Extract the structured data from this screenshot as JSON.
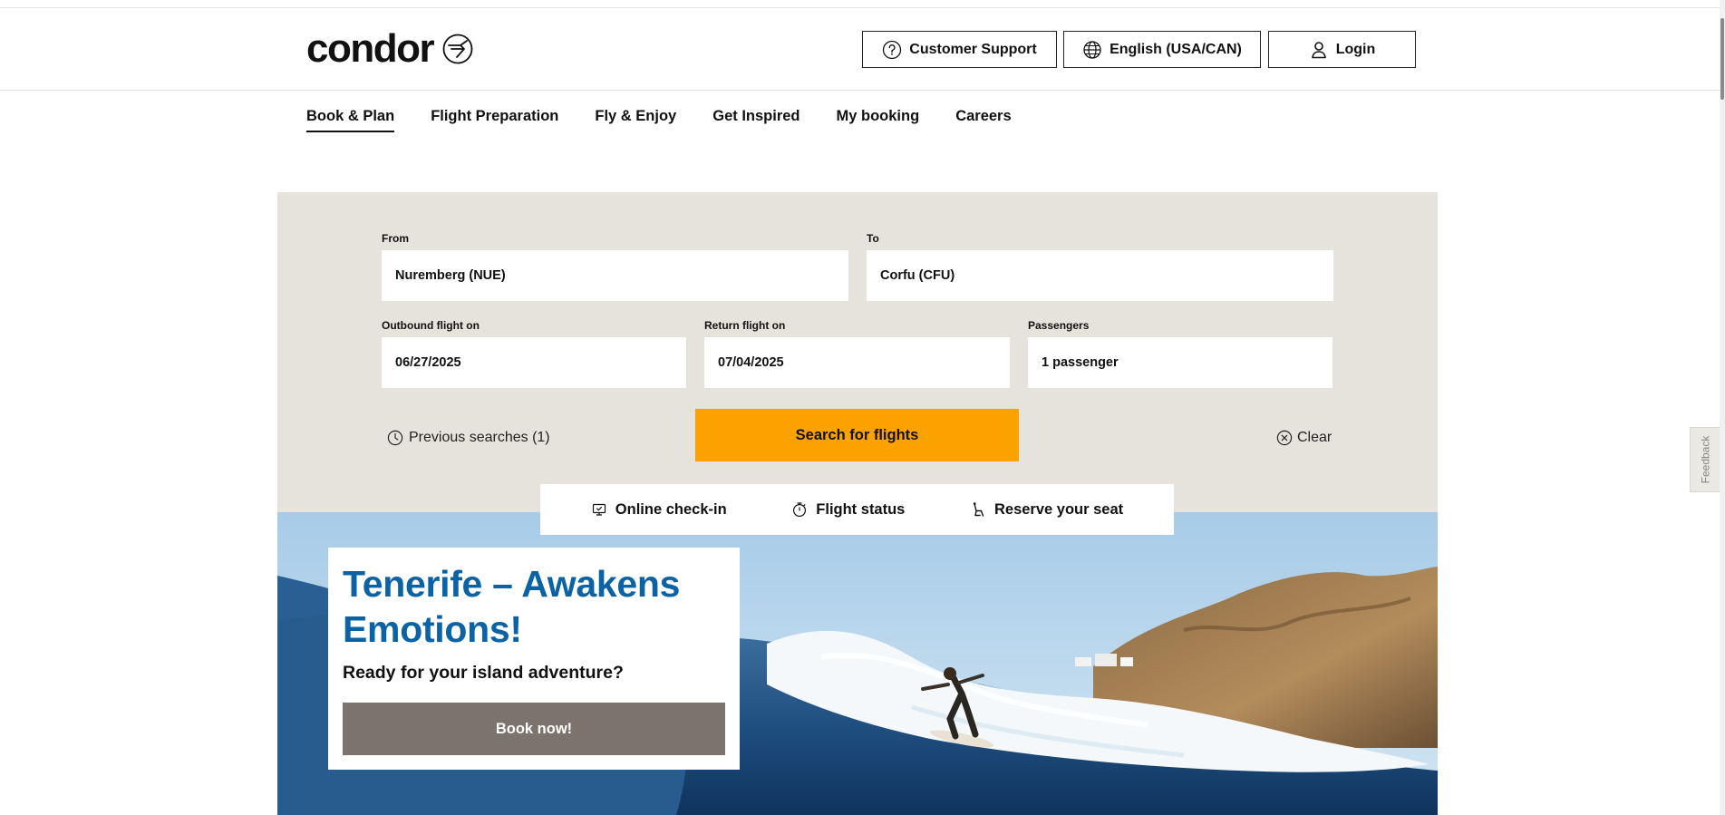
{
  "header": {
    "logo_text": "condor",
    "support_label": "Customer Support",
    "language_label": "English (USA/CAN)",
    "login_label": "Login"
  },
  "nav": {
    "items": [
      {
        "label": "Book & Plan",
        "active": true
      },
      {
        "label": "Flight Preparation"
      },
      {
        "label": "Fly & Enjoy"
      },
      {
        "label": "Get Inspired"
      },
      {
        "label": "My booking"
      },
      {
        "label": "Careers"
      }
    ]
  },
  "booking": {
    "from_label": "From",
    "from_value": "Nuremberg (NUE)",
    "to_label": "To",
    "to_value": "Corfu (CFU)",
    "outbound_label": "Outbound flight on",
    "outbound_value": "06/27/2025",
    "return_label": "Return flight on",
    "return_value": "07/04/2025",
    "passengers_label": "Passengers",
    "passengers_value": "1 passenger",
    "previous_searches": "Previous searches (1)",
    "search_button": "Search for flights",
    "clear_label": "Clear"
  },
  "quick_links": {
    "checkin": "Online check-in",
    "status": "Flight status",
    "seat": "Reserve your seat"
  },
  "promo": {
    "title": "Tenerife – Awakens Emotions!",
    "subtitle": "Ready for your island adventure?",
    "button": "Book now!"
  },
  "feedback_label": "Feedback",
  "colors": {
    "accent": "#fba100",
    "promo_title": "#0b63a5",
    "panel_bg": "#e6e3dc",
    "promo_button": "#7d736d"
  },
  "icons": [
    "condor-logo-icon",
    "question-circle-icon",
    "globe-icon",
    "user-icon",
    "clock-icon",
    "close-circle-icon",
    "monitor-checkin-icon",
    "stopwatch-icon",
    "seat-icon"
  ]
}
